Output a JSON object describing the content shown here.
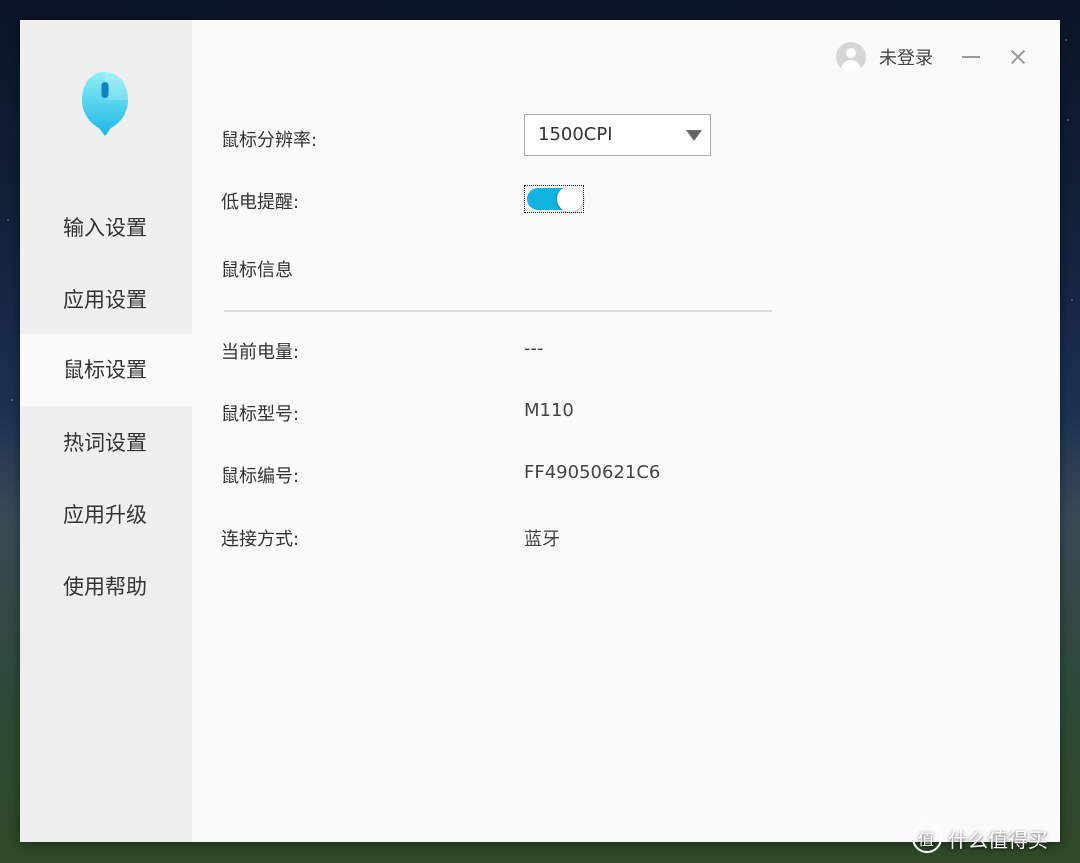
{
  "sidebar": {
    "items": [
      {
        "label": "输入设置"
      },
      {
        "label": "应用设置"
      },
      {
        "label": "鼠标设置"
      },
      {
        "label": "热词设置"
      },
      {
        "label": "应用升级"
      },
      {
        "label": "使用帮助"
      }
    ],
    "active_index": 2
  },
  "topbar": {
    "login_text": "未登录"
  },
  "settings": {
    "resolution_label": "鼠标分辨率:",
    "resolution_value": "1500CPI",
    "low_battery_label": "低电提醒:",
    "low_battery_enabled": true
  },
  "info": {
    "section_title": "鼠标信息",
    "battery_label": "当前电量:",
    "battery_value": "---",
    "model_label": "鼠标型号:",
    "model_value": "M110",
    "serial_label": "鼠标编号:",
    "serial_value": "FF49050621C6",
    "connection_label": "连接方式:",
    "connection_value": "蓝牙"
  },
  "watermark": {
    "text": "什么值得买"
  },
  "colors": {
    "accent": "#0fb3e0",
    "sidebar_bg": "#efefef",
    "content_bg": "#fafafa"
  }
}
